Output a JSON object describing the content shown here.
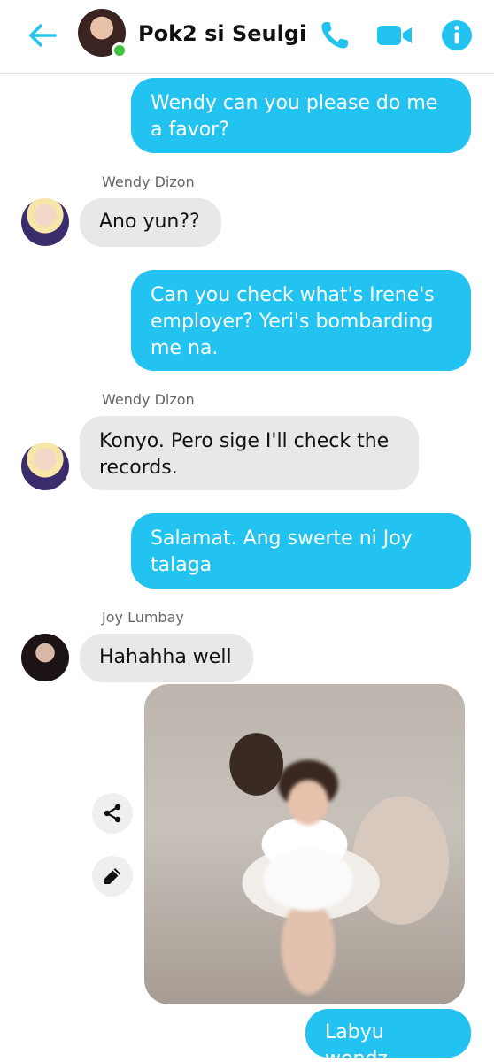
{
  "header": {
    "title": "Pok2 si Seulgi",
    "icons": {
      "back": "arrow-left-icon",
      "call": "phone-icon",
      "video": "video-camera-icon",
      "info": "info-icon"
    },
    "online": true
  },
  "colors": {
    "accent": "#22c3f0",
    "outgoing_bubble": "#22c3f0",
    "incoming_bubble": "#e8e8e8",
    "online_dot": "#42c042"
  },
  "messages": [
    {
      "direction": "out",
      "text": "Wendy can you please do me\na favor?"
    },
    {
      "direction": "in",
      "sender": "Wendy Dizon",
      "text": "Ano yun??"
    },
    {
      "direction": "out",
      "text": "Can you check what's Irene's\nemployer? Yeri's bombarding\nme na."
    },
    {
      "direction": "in",
      "sender": "Wendy Dizon",
      "text": "Konyo. Pero sige I'll check the\nrecords."
    },
    {
      "direction": "out",
      "text": "Salamat. Ang swerte ni Joy\ntalaga"
    },
    {
      "direction": "in",
      "sender": "Joy Lumbay",
      "text": "Hahahha well"
    },
    {
      "direction": "in",
      "type": "photo"
    },
    {
      "direction": "out",
      "text": "Labyu wendz"
    }
  ],
  "photo_actions": {
    "share": "share-icon",
    "edit": "pencil-icon"
  }
}
